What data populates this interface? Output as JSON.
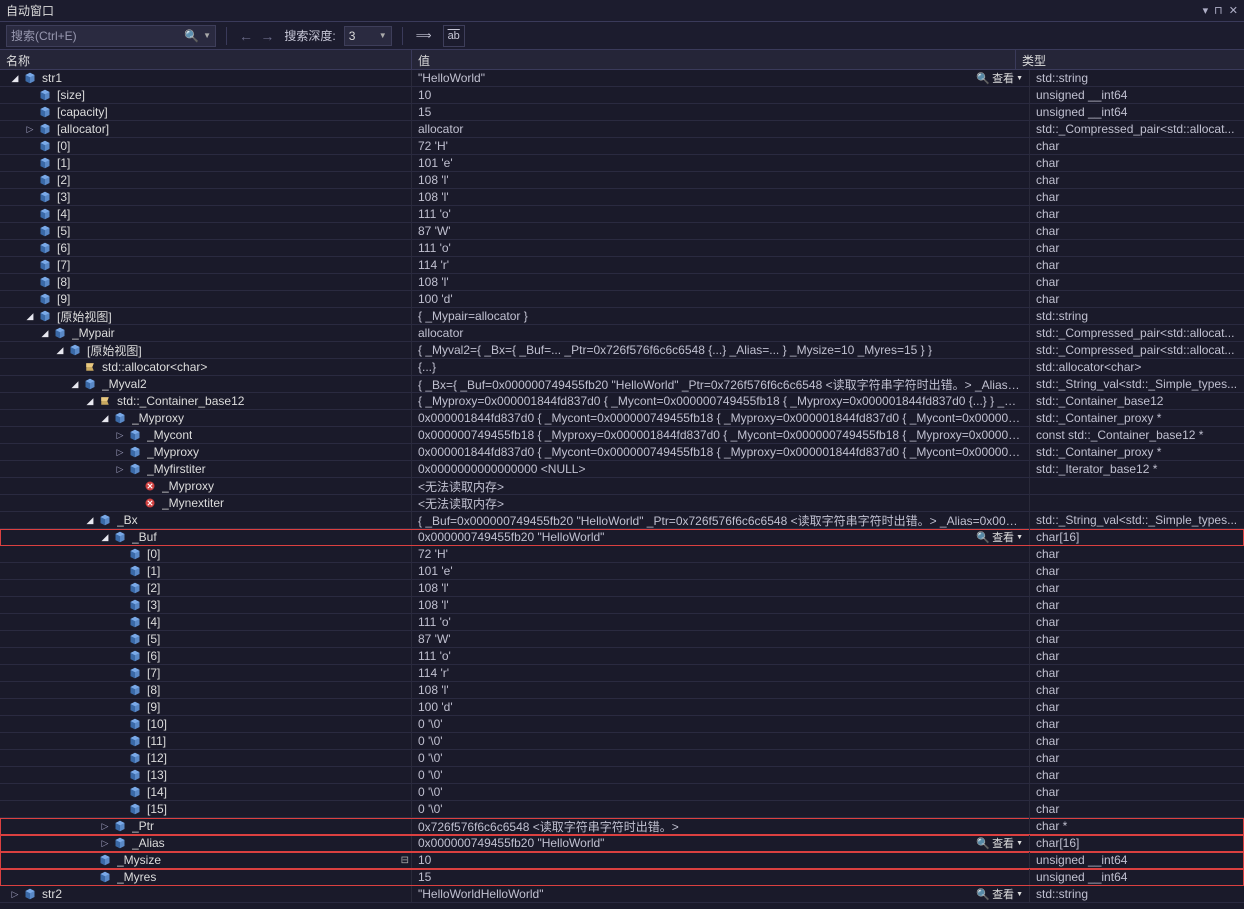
{
  "window": {
    "title": "自动窗口",
    "dropdown_icon": "▾",
    "pin_icon": "⊔",
    "close_icon": "✕"
  },
  "toolbar": {
    "search_placeholder": "搜索(Ctrl+E)",
    "back_icon": "←",
    "forward_icon": "→",
    "depth_label": "搜索深度:",
    "depth_value": "3",
    "btn_expr": "⟹",
    "btn_ab": "ab"
  },
  "columns": {
    "name": "名称",
    "value": "值",
    "type": "类型"
  },
  "view_label": "查看",
  "rows": [
    {
      "depth": 0,
      "exp": "open",
      "ico": "cube",
      "name": "str1",
      "value": "\"HelloWorld\"",
      "type": "std::string",
      "view": true
    },
    {
      "depth": 1,
      "exp": "none",
      "ico": "cube",
      "name": "[size]",
      "value": "10",
      "type": "unsigned __int64"
    },
    {
      "depth": 1,
      "exp": "none",
      "ico": "cube",
      "name": "[capacity]",
      "value": "15",
      "type": "unsigned __int64"
    },
    {
      "depth": 1,
      "exp": "closed",
      "ico": "cube",
      "name": "[allocator]",
      "value": "allocator",
      "type": "std::_Compressed_pair<std::allocat..."
    },
    {
      "depth": 1,
      "exp": "none",
      "ico": "cube",
      "name": "[0]",
      "value": "72 'H'",
      "type": "char"
    },
    {
      "depth": 1,
      "exp": "none",
      "ico": "cube",
      "name": "[1]",
      "value": "101 'e'",
      "type": "char"
    },
    {
      "depth": 1,
      "exp": "none",
      "ico": "cube",
      "name": "[2]",
      "value": "108 'l'",
      "type": "char"
    },
    {
      "depth": 1,
      "exp": "none",
      "ico": "cube",
      "name": "[3]",
      "value": "108 'l'",
      "type": "char"
    },
    {
      "depth": 1,
      "exp": "none",
      "ico": "cube",
      "name": "[4]",
      "value": "111 'o'",
      "type": "char"
    },
    {
      "depth": 1,
      "exp": "none",
      "ico": "cube",
      "name": "[5]",
      "value": "87 'W'",
      "type": "char"
    },
    {
      "depth": 1,
      "exp": "none",
      "ico": "cube",
      "name": "[6]",
      "value": "111 'o'",
      "type": "char"
    },
    {
      "depth": 1,
      "exp": "none",
      "ico": "cube",
      "name": "[7]",
      "value": "114 'r'",
      "type": "char"
    },
    {
      "depth": 1,
      "exp": "none",
      "ico": "cube",
      "name": "[8]",
      "value": "108 'l'",
      "type": "char"
    },
    {
      "depth": 1,
      "exp": "none",
      "ico": "cube",
      "name": "[9]",
      "value": "100 'd'",
      "type": "char"
    },
    {
      "depth": 1,
      "exp": "open",
      "ico": "cube",
      "name": "[原始视图]",
      "value": "{ _Mypair=allocator }",
      "type": "std::string"
    },
    {
      "depth": 2,
      "exp": "open",
      "ico": "cube",
      "name": "_Mypair",
      "value": "allocator",
      "type": "std::_Compressed_pair<std::allocat..."
    },
    {
      "depth": 3,
      "exp": "open",
      "ico": "cube",
      "name": "[原始视图]",
      "value": "{ _Myval2={ _Bx={ _Buf=... _Ptr=0x726f576f6c6c6548 {...} _Alias=... } _Mysize=10 _Myres=15 } }",
      "type": "std::_Compressed_pair<std::allocat..."
    },
    {
      "depth": 4,
      "exp": "none",
      "ico": "class",
      "name": "std::allocator<char>",
      "value": "{...}",
      "type": "std::allocator<char>"
    },
    {
      "depth": 4,
      "exp": "open",
      "ico": "cube",
      "name": "_Myval2",
      "value": "{ _Bx={ _Buf=0x000000749455fb20 \"HelloWorld\"  _Ptr=0x726f576f6c6c6548 <读取字符串字符时出错。> _Alias=0...",
      "type": "std::_String_val<std::_Simple_types..."
    },
    {
      "depth": 5,
      "exp": "open",
      "ico": "class",
      "name": "std::_Container_base12",
      "value": "{ _Myproxy=0x000001844fd837d0 { _Mycont=0x000000749455fb18 { _Myproxy=0x000001844fd837d0 {...} } _Myfirstit...",
      "type": "std::_Container_base12"
    },
    {
      "depth": 6,
      "exp": "open",
      "ico": "cube",
      "name": "_Myproxy",
      "value": "0x000001844fd837d0 { _Mycont=0x000000749455fb18 { _Myproxy=0x000001844fd837d0 { _Mycont=0x0000007945...",
      "type": "std::_Container_proxy *"
    },
    {
      "depth": 7,
      "exp": "closed",
      "ico": "cube",
      "name": "_Mycont",
      "value": "0x000000749455fb18 { _Myproxy=0x000001844fd837d0 { _Mycont=0x000000749455fb18 { _Myproxy=0x000001844fd...",
      "type": "const std::_Container_base12 *"
    },
    {
      "depth": 7,
      "exp": "closed",
      "ico": "cube",
      "name": "_Myproxy",
      "value": "0x000001844fd837d0 { _Mycont=0x000000749455fb18 { _Myproxy=0x000001844fd837d0 { _Mycont=0x0000007945...",
      "type": "std::_Container_proxy *"
    },
    {
      "depth": 7,
      "exp": "closed",
      "ico": "cube",
      "name": "_Myfirstiter",
      "value": "0x0000000000000000 <NULL>",
      "type": "std::_Iterator_base12 *"
    },
    {
      "depth": 8,
      "exp": "none",
      "ico": "err",
      "name": "_Myproxy",
      "value": "<无法读取内存>",
      "type": ""
    },
    {
      "depth": 8,
      "exp": "none",
      "ico": "err",
      "name": "_Mynextiter",
      "value": "<无法读取内存>",
      "type": ""
    },
    {
      "depth": 5,
      "exp": "open",
      "ico": "cube",
      "name": "_Bx",
      "value": "{ _Buf=0x000000749455fb20 \"HelloWorld\" _Ptr=0x726f576f6c6c6548 <读取字符串字符时出错。> _Alias=0x0000...",
      "type": "std::_String_val<std::_Simple_types..."
    },
    {
      "depth": 6,
      "exp": "open",
      "ico": "cube",
      "name": "_Buf",
      "value": "0x000000749455fb20 \"HelloWorld\"",
      "type": "char[16]",
      "hl": true,
      "view": true
    },
    {
      "depth": 7,
      "exp": "none",
      "ico": "cube",
      "name": "[0]",
      "value": "72 'H'",
      "type": "char"
    },
    {
      "depth": 7,
      "exp": "none",
      "ico": "cube",
      "name": "[1]",
      "value": "101 'e'",
      "type": "char"
    },
    {
      "depth": 7,
      "exp": "none",
      "ico": "cube",
      "name": "[2]",
      "value": "108 'l'",
      "type": "char"
    },
    {
      "depth": 7,
      "exp": "none",
      "ico": "cube",
      "name": "[3]",
      "value": "108 'l'",
      "type": "char"
    },
    {
      "depth": 7,
      "exp": "none",
      "ico": "cube",
      "name": "[4]",
      "value": "111 'o'",
      "type": "char"
    },
    {
      "depth": 7,
      "exp": "none",
      "ico": "cube",
      "name": "[5]",
      "value": "87 'W'",
      "type": "char"
    },
    {
      "depth": 7,
      "exp": "none",
      "ico": "cube",
      "name": "[6]",
      "value": "111 'o'",
      "type": "char"
    },
    {
      "depth": 7,
      "exp": "none",
      "ico": "cube",
      "name": "[7]",
      "value": "114 'r'",
      "type": "char"
    },
    {
      "depth": 7,
      "exp": "none",
      "ico": "cube",
      "name": "[8]",
      "value": "108 'l'",
      "type": "char"
    },
    {
      "depth": 7,
      "exp": "none",
      "ico": "cube",
      "name": "[9]",
      "value": "100 'd'",
      "type": "char"
    },
    {
      "depth": 7,
      "exp": "none",
      "ico": "cube",
      "name": "[10]",
      "value": "0 '\\0'",
      "type": "char"
    },
    {
      "depth": 7,
      "exp": "none",
      "ico": "cube",
      "name": "[11]",
      "value": "0 '\\0'",
      "type": "char"
    },
    {
      "depth": 7,
      "exp": "none",
      "ico": "cube",
      "name": "[12]",
      "value": "0 '\\0'",
      "type": "char"
    },
    {
      "depth": 7,
      "exp": "none",
      "ico": "cube",
      "name": "[13]",
      "value": "0 '\\0'",
      "type": "char"
    },
    {
      "depth": 7,
      "exp": "none",
      "ico": "cube",
      "name": "[14]",
      "value": "0 '\\0'",
      "type": "char"
    },
    {
      "depth": 7,
      "exp": "none",
      "ico": "cube",
      "name": "[15]",
      "value": "0 '\\0'",
      "type": "char"
    },
    {
      "depth": 6,
      "exp": "closed",
      "ico": "cube",
      "name": "_Ptr",
      "value": "0x726f576f6c6c6548 <读取字符串字符时出错。>",
      "type": "char *",
      "hl": true
    },
    {
      "depth": 6,
      "exp": "closed",
      "ico": "cube",
      "name": "_Alias",
      "value": "0x000000749455fb20 \"HelloWorld\"",
      "type": "char[16]",
      "hl": true,
      "view": true
    },
    {
      "depth": 5,
      "exp": "none",
      "ico": "cube",
      "name": "_Mysize",
      "value": "10",
      "type": "unsigned __int64",
      "hl": true,
      "pin": true
    },
    {
      "depth": 5,
      "exp": "none",
      "ico": "cube",
      "name": "_Myres",
      "value": "15",
      "type": "unsigned __int64",
      "hl": true
    },
    {
      "depth": 0,
      "exp": "closed",
      "ico": "cube",
      "name": "str2",
      "value": "\"HelloWorldHelloWorld\"",
      "type": "std::string",
      "view": true
    }
  ]
}
